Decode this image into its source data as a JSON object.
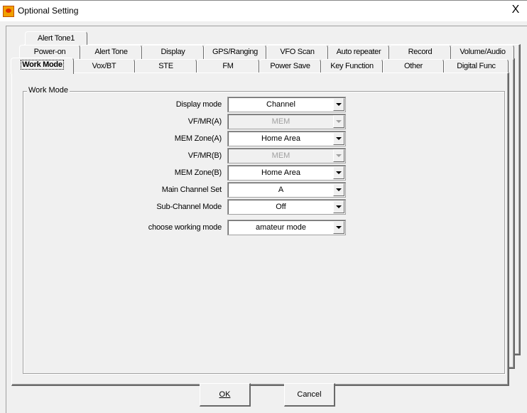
{
  "window": {
    "title": "Optional Setting",
    "close_label": "X"
  },
  "tabs": {
    "row3": [
      "Alert Tone1"
    ],
    "row2": [
      "Power-on",
      "Alert Tone",
      "Display",
      "GPS/Ranging",
      "VFO Scan",
      "Auto repeater",
      "Record",
      "Volume/Audio"
    ],
    "row1": [
      "Work Mode",
      "Vox/BT",
      "STE",
      "FM",
      "Power Save",
      "Key Function",
      "Other",
      "Digital Func"
    ],
    "selected": "Work Mode"
  },
  "group": {
    "title": "Work Mode"
  },
  "fields": [
    {
      "label": "Display mode",
      "value": "Channel",
      "enabled": true
    },
    {
      "label": "VF/MR(A)",
      "value": "MEM",
      "enabled": false
    },
    {
      "label": "MEM Zone(A)",
      "value": "Home Area",
      "enabled": true
    },
    {
      "label": "VF/MR(B)",
      "value": "MEM",
      "enabled": false
    },
    {
      "label": "MEM Zone(B)",
      "value": "Home Area",
      "enabled": true
    },
    {
      "label": "Main Channel Set",
      "value": "A",
      "enabled": true
    },
    {
      "label": "Sub-Channel Mode",
      "value": "Off",
      "enabled": true
    },
    {
      "label": "choose working mode",
      "value": "amateur mode",
      "enabled": true
    }
  ],
  "buttons": {
    "ok": "OK",
    "cancel": "Cancel"
  }
}
